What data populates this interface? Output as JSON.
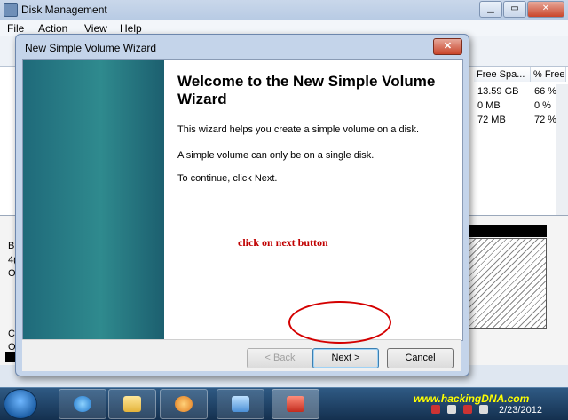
{
  "window": {
    "title": "Disk Management",
    "menu": [
      "File",
      "Action",
      "View",
      "Help"
    ],
    "columns": [
      "Free Spa...",
      "% Free"
    ],
    "rows": [
      {
        "free": "13.59 GB",
        "pct": "66 %"
      },
      {
        "free": "0 MB",
        "pct": "0 %"
      },
      {
        "free": "72 MB",
        "pct": "72 %"
      }
    ],
    "left_fragments": [
      "B",
      "4(",
      "O",
      "C",
      "O"
    ]
  },
  "wizard": {
    "title": "New Simple Volume Wizard",
    "close_label": "✕",
    "heading": "Welcome to the New Simple Volume Wizard",
    "line1": "This wizard helps you create a simple volume on a disk.",
    "line2": "A simple volume can only be on a single disk.",
    "line3": "To continue, click Next.",
    "buttons": {
      "back": "< Back",
      "next": "Next >",
      "cancel": "Cancel"
    }
  },
  "annotation": "click on next button",
  "taskbar": {
    "brand": "www.hackingDNA.com",
    "date": "2/23/2012",
    "icons": [
      "start-orb-icon",
      "internet-explorer-icon",
      "folder-icon",
      "media-player-icon",
      "control-panel-icon",
      "toolbox-icon"
    ]
  },
  "colors": {
    "annotation": "#c00000",
    "highlight_circle": "#d40000",
    "wizard_side": "#2f8a8e",
    "brand": "#ffff00"
  }
}
